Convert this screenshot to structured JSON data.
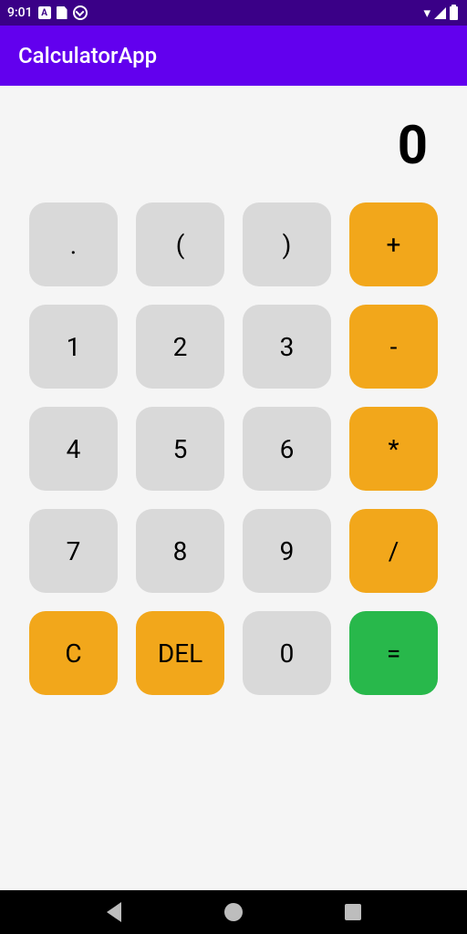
{
  "status": {
    "time": "9:01",
    "iconA": "A"
  },
  "app": {
    "title": "CalculatorApp"
  },
  "display": {
    "value": "0"
  },
  "keypad": {
    "rows": [
      [
        {
          "id": "dot",
          "label": ".",
          "style": "gray"
        },
        {
          "id": "open-paren",
          "label": "(",
          "style": "gray"
        },
        {
          "id": "close-paren",
          "label": ")",
          "style": "gray"
        },
        {
          "id": "plus",
          "label": "+",
          "style": "orange"
        }
      ],
      [
        {
          "id": "one",
          "label": "1",
          "style": "gray"
        },
        {
          "id": "two",
          "label": "2",
          "style": "gray"
        },
        {
          "id": "three",
          "label": "3",
          "style": "gray"
        },
        {
          "id": "minus",
          "label": "-",
          "style": "orange"
        }
      ],
      [
        {
          "id": "four",
          "label": "4",
          "style": "gray"
        },
        {
          "id": "five",
          "label": "5",
          "style": "gray"
        },
        {
          "id": "six",
          "label": "6",
          "style": "gray"
        },
        {
          "id": "multiply",
          "label": "*",
          "style": "orange"
        }
      ],
      [
        {
          "id": "seven",
          "label": "7",
          "style": "gray"
        },
        {
          "id": "eight",
          "label": "8",
          "style": "gray"
        },
        {
          "id": "nine",
          "label": "9",
          "style": "gray"
        },
        {
          "id": "divide",
          "label": "/",
          "style": "orange"
        }
      ],
      [
        {
          "id": "clear",
          "label": "C",
          "style": "orange"
        },
        {
          "id": "delete",
          "label": "DEL",
          "style": "orange"
        },
        {
          "id": "zero",
          "label": "0",
          "style": "gray"
        },
        {
          "id": "equals",
          "label": "=",
          "style": "green"
        }
      ]
    ]
  },
  "colors": {
    "brand": "#6200EE",
    "statusBar": "#3a0087",
    "keyGray": "#d9d9d9",
    "keyOrange": "#f2a71b",
    "keyGreen": "#28b84b",
    "surface": "#f5f5f5"
  }
}
